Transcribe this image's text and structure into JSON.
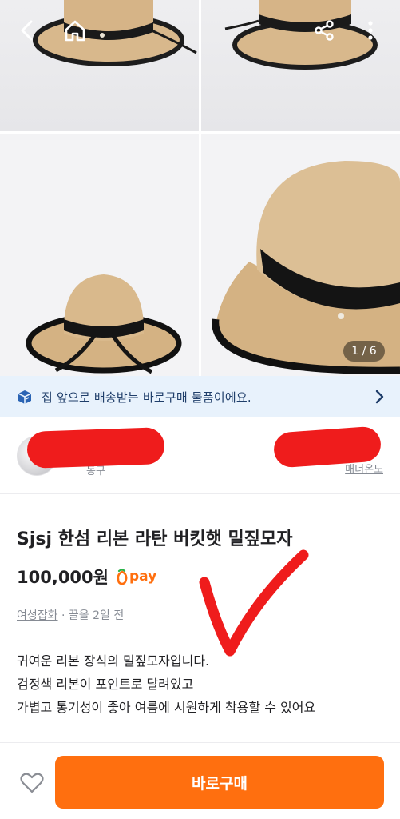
{
  "gallery": {
    "counter": "1 / 6"
  },
  "top_bar": {
    "back_icon": "chevron-left-icon",
    "home_icon": "home-icon",
    "share_icon": "share-icon",
    "more_icon": "more-vertical-icon"
  },
  "banner": {
    "text": "집 앞으로 배송받는 바로구매 물품이에요.",
    "icon": "delivery-box-icon"
  },
  "seller": {
    "location": "동구",
    "manner_label": "매너온도"
  },
  "product": {
    "title": "Sjsj 한섬 리본 라탄 버킷햇 밀짚모자",
    "price": "100,000원",
    "pay_label": "pay",
    "category": "여성잡화",
    "time": "· 끌올 2일 전",
    "description": [
      "귀여운 리본 장식의 밀짚모자입니다.",
      "검정색 리본이 포인트로 달려있고",
      "가볍고 통기성이 좋아 여름에 시원하게 착용할 수 있어요"
    ]
  },
  "bottom_bar": {
    "buy_label": "바로구매",
    "like_icon": "heart-outline-icon"
  },
  "colors": {
    "accent": "#ff6f0f",
    "banner_bg": "#e8f2fc",
    "banner_text": "#1f3e6a",
    "redaction": "#ef1c1c"
  }
}
